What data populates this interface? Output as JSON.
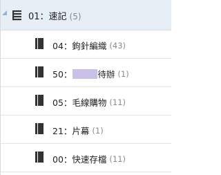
{
  "group": {
    "label": "01：速記",
    "count": "(5)"
  },
  "notebooks": [
    {
      "prefix": "04：鉤針編織",
      "suffix": "",
      "count": "(43)",
      "redacted": false
    },
    {
      "prefix": "50：",
      "suffix": "待辦",
      "count": "(1)",
      "redacted": true
    },
    {
      "prefix": "05：毛線購物",
      "suffix": "",
      "count": "(11)",
      "redacted": false
    },
    {
      "prefix": "21：片幕",
      "suffix": "",
      "count": "(1)",
      "redacted": false
    },
    {
      "prefix": "00：快速存檔",
      "suffix": "",
      "count": "(11)",
      "redacted": false
    }
  ],
  "icons": {
    "group": "notebook-stack-icon",
    "notebook": "notebook-icon"
  },
  "colors": {
    "header_bg": "#e6eef6",
    "redaction": "#c9c2e6"
  }
}
